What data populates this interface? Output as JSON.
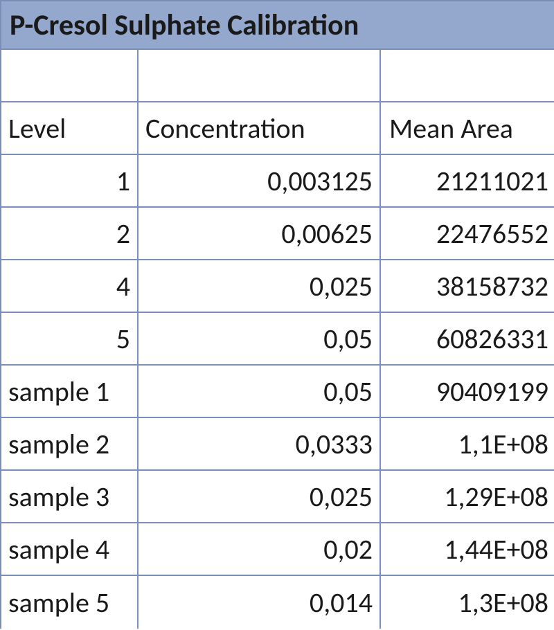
{
  "title": "P-Cresol Sulphate Calibration",
  "headers": {
    "level": "Level",
    "concentration": "Concentration",
    "mean_area": "Mean Area"
  },
  "rows": [
    {
      "level": "1",
      "level_align": "right",
      "concentration": "0,003125",
      "mean_area": "21211021"
    },
    {
      "level": "2",
      "level_align": "right",
      "concentration": "0,00625",
      "mean_area": "22476552"
    },
    {
      "level": "4",
      "level_align": "right",
      "concentration": "0,025",
      "mean_area": "38158732"
    },
    {
      "level": "5",
      "level_align": "right",
      "concentration": "0,05",
      "mean_area": "60826331"
    },
    {
      "level": "sample 1",
      "level_align": "left",
      "concentration": "0,05",
      "mean_area": "90409199"
    },
    {
      "level": "sample 2",
      "level_align": "left",
      "concentration": "0,0333",
      "mean_area": "1,1E+08"
    },
    {
      "level": "sample 3",
      "level_align": "left",
      "concentration": "0,025",
      "mean_area": "1,29E+08"
    },
    {
      "level": "sample 4",
      "level_align": "left",
      "concentration": "0,02",
      "mean_area": "1,44E+08"
    },
    {
      "level": "sample 5",
      "level_align": "left",
      "concentration": "0,014",
      "mean_area": "1,3E+08"
    }
  ],
  "chart_data": {
    "type": "table",
    "title": "P-Cresol Sulphate Calibration",
    "columns": [
      "Level",
      "Concentration",
      "Mean Area"
    ],
    "data": [
      [
        "1",
        0.003125,
        21211021
      ],
      [
        "2",
        0.00625,
        22476552
      ],
      [
        "4",
        0.025,
        38158732
      ],
      [
        "5",
        0.05,
        60826331
      ],
      [
        "sample 1",
        0.05,
        90409199
      ],
      [
        "sample 2",
        0.0333,
        110000000
      ],
      [
        "sample 3",
        0.025,
        129000000
      ],
      [
        "sample 4",
        0.02,
        144000000
      ],
      [
        "sample 5",
        0.014,
        130000000
      ]
    ]
  }
}
